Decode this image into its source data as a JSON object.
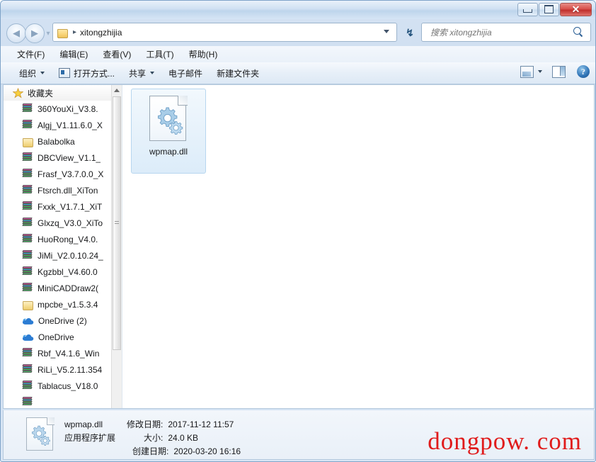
{
  "window": {
    "controls": {
      "minimize": "Minimize",
      "maximize": "Maximize",
      "close": "✕"
    }
  },
  "address": {
    "path_text": "xitongzhijia",
    "separator": "▸",
    "refresh": "↯"
  },
  "search": {
    "placeholder": "搜索 xitongzhijia",
    "value": ""
  },
  "menubar": {
    "items": [
      {
        "label": "文件(F)"
      },
      {
        "label": "编辑(E)"
      },
      {
        "label": "查看(V)"
      },
      {
        "label": "工具(T)"
      },
      {
        "label": "帮助(H)"
      }
    ]
  },
  "toolbar": {
    "organize": "组织",
    "open_with": "打开方式...",
    "share": "共享",
    "email": "电子邮件",
    "new_folder": "新建文件夹",
    "help_glyph": "?"
  },
  "sidebar": {
    "header": "收藏夹",
    "items": [
      {
        "label": "360YouXi_V3.8.",
        "icon": "book-icon"
      },
      {
        "label": "Algj_V1.11.6.0_X",
        "icon": "book-icon"
      },
      {
        "label": "Balabolka",
        "icon": "folder-icon"
      },
      {
        "label": "DBCView_V1.1_",
        "icon": "book-icon"
      },
      {
        "label": "Frasf_V3.7.0.0_X",
        "icon": "book-icon"
      },
      {
        "label": "Ftsrch.dll_XiTon",
        "icon": "book-icon"
      },
      {
        "label": "Fxxk_V1.7.1_XiT",
        "icon": "book-icon"
      },
      {
        "label": "Glxzq_V3.0_XiTo",
        "icon": "book-icon"
      },
      {
        "label": "HuoRong_V4.0.",
        "icon": "book-icon"
      },
      {
        "label": "JiMi_V2.0.10.24_",
        "icon": "book-icon"
      },
      {
        "label": "Kgzbbl_V4.60.0",
        "icon": "book-icon"
      },
      {
        "label": "MiniCADDraw2(",
        "icon": "book-icon"
      },
      {
        "label": "mpcbe_v1.5.3.4",
        "icon": "folder-icon"
      },
      {
        "label": "OneDrive (2)",
        "icon": "cloud-icon"
      },
      {
        "label": "OneDrive",
        "icon": "cloud-icon"
      },
      {
        "label": "Rbf_V4.1.6_Win",
        "icon": "book-icon"
      },
      {
        "label": "RiLi_V5.2.11.354",
        "icon": "book-icon"
      },
      {
        "label": "Tablacus_V18.0",
        "icon": "book-icon"
      }
    ]
  },
  "content": {
    "file": {
      "name": "wpmap.dll",
      "icon": "dll-gear-icon",
      "selected": true
    }
  },
  "statusbar": {
    "file_name": "wpmap.dll",
    "file_type": "应用程序扩展",
    "modified_label": "修改日期:",
    "modified_value": "2017-11-12 11:57",
    "size_label": "大小:",
    "size_value": "24.0 KB",
    "created_label": "创建日期:",
    "created_value": "2020-03-20 16:16"
  },
  "watermark": {
    "text": "dongpow. com",
    "color": "#e01b1b"
  },
  "colors": {
    "window_frame": "#7ea3c8",
    "titlebar_top": "#e9f1fa",
    "close_button": "#c02f2c",
    "selection": "#dcecf9",
    "accent": "#2e6ca8"
  }
}
